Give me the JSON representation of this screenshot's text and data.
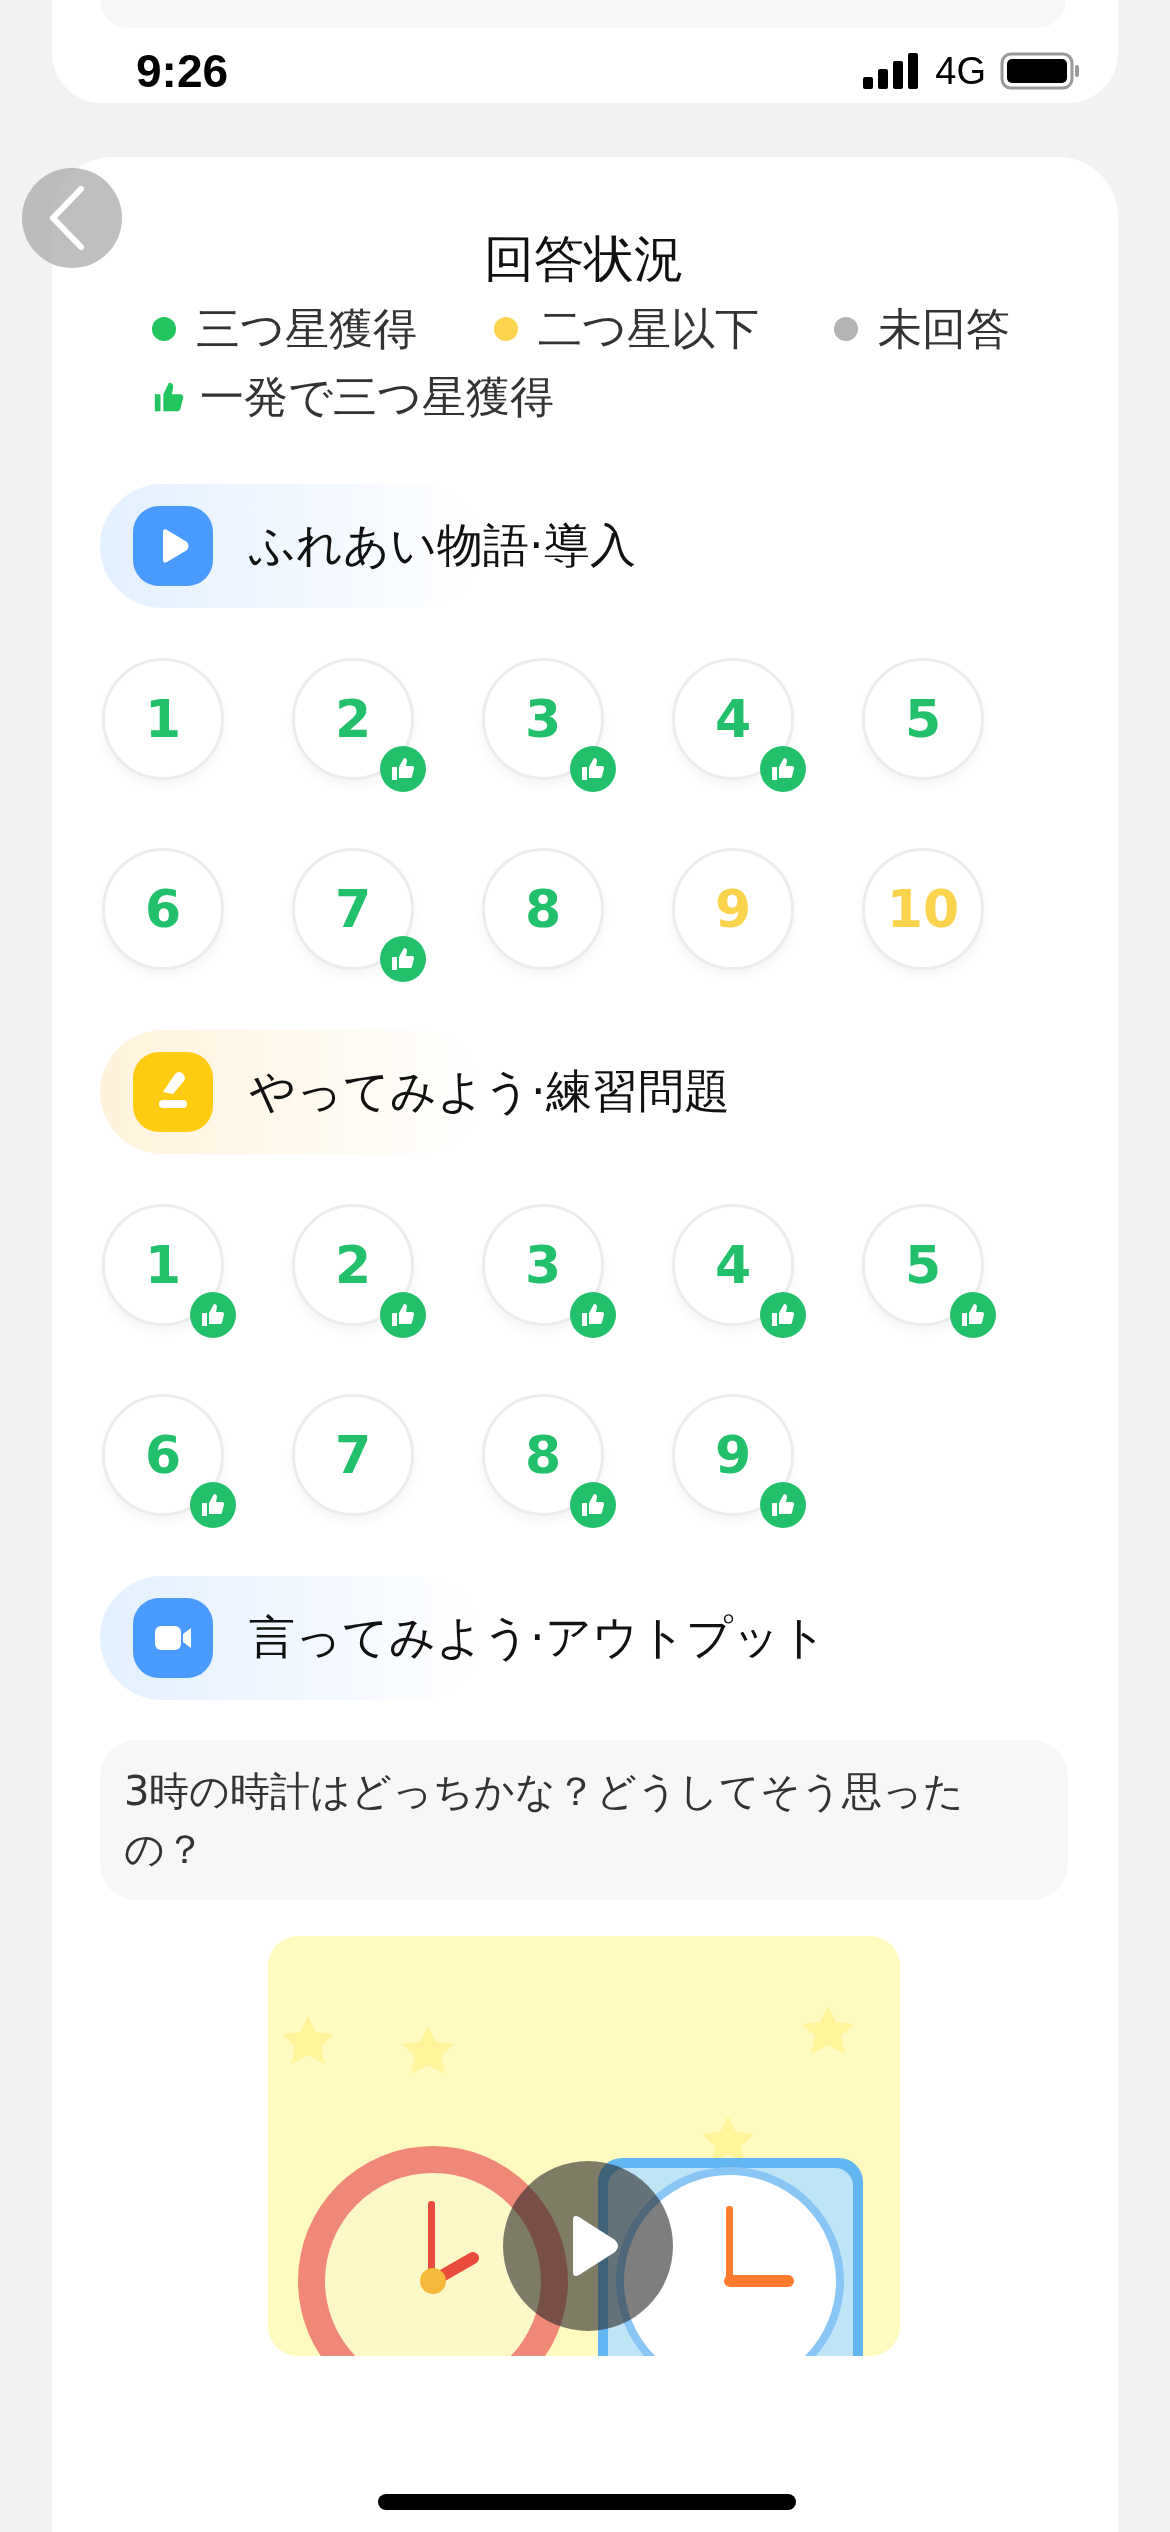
{
  "status_bar": {
    "time": "9:26",
    "network": "4G"
  },
  "title": "回答状況",
  "legend": [
    {
      "kind": "dot",
      "label": "三つ星獲得",
      "color": "#22c55e"
    },
    {
      "kind": "dot",
      "label": "二つ星以下",
      "color": "#fcd34d"
    },
    {
      "kind": "dot",
      "label": "未回答",
      "color": "#b3b3b3"
    },
    {
      "kind": "thumb",
      "label": "一発で三つ星獲得",
      "color": "#22c55e"
    }
  ],
  "sections": [
    {
      "kind": "video",
      "title": "ふれあい物語·導入",
      "items": [
        {
          "number": "1",
          "color": "#22c06a",
          "first_try": false
        },
        {
          "number": "2",
          "color": "#22c06a",
          "first_try": true
        },
        {
          "number": "3",
          "color": "#22c06a",
          "first_try": true
        },
        {
          "number": "4",
          "color": "#22c06a",
          "first_try": true
        },
        {
          "number": "5",
          "color": "#22c06a",
          "first_try": false
        },
        {
          "number": "6",
          "color": "#22c06a",
          "first_try": false
        },
        {
          "number": "7",
          "color": "#22c06a",
          "first_try": true
        },
        {
          "number": "8",
          "color": "#22c06a",
          "first_try": false
        },
        {
          "number": "9",
          "color": "#fcd34d",
          "first_try": false
        },
        {
          "number": "10",
          "color": "#fcd34d",
          "first_try": false
        }
      ]
    },
    {
      "kind": "practice",
      "title": "やってみよう·練習問題",
      "items": [
        {
          "number": "1",
          "color": "#22c06a",
          "first_try": true
        },
        {
          "number": "2",
          "color": "#22c06a",
          "first_try": true
        },
        {
          "number": "3",
          "color": "#22c06a",
          "first_try": true
        },
        {
          "number": "4",
          "color": "#22c06a",
          "first_try": true
        },
        {
          "number": "5",
          "color": "#22c06a",
          "first_try": true
        },
        {
          "number": "6",
          "color": "#22c06a",
          "first_try": true
        },
        {
          "number": "7",
          "color": "#22c06a",
          "first_try": false
        },
        {
          "number": "8",
          "color": "#22c06a",
          "first_try": true
        },
        {
          "number": "9",
          "color": "#22c06a",
          "first_try": true
        }
      ]
    },
    {
      "kind": "output",
      "title": "言ってみよう·アウトプット",
      "question": "3時の時計はどっちかな？どうしてそう思ったの？"
    }
  ]
}
